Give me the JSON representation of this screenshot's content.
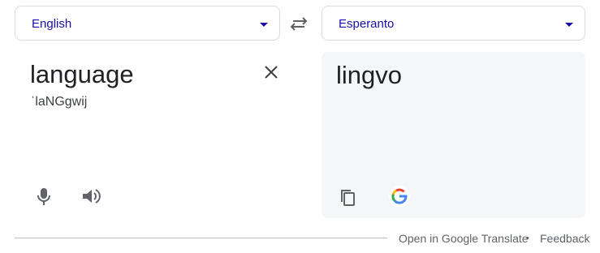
{
  "source": {
    "language": "English",
    "text": "language",
    "transliteration": "ˈlaNGgwij"
  },
  "target": {
    "language": "Esperanto",
    "text": "lingvo"
  },
  "icons": {
    "swap": "swap-arrows-icon",
    "clear": "close-icon",
    "mic": "microphone-icon",
    "speaker": "speaker-icon",
    "copy": "copy-icon",
    "google": "google-g-icon"
  },
  "footer": {
    "open_link": "Open in Google Translate",
    "separator": "•",
    "feedback": "Feedback"
  },
  "colors": {
    "language_label": "#1a0dab",
    "target_panel_bg": "#f5f6f8"
  }
}
